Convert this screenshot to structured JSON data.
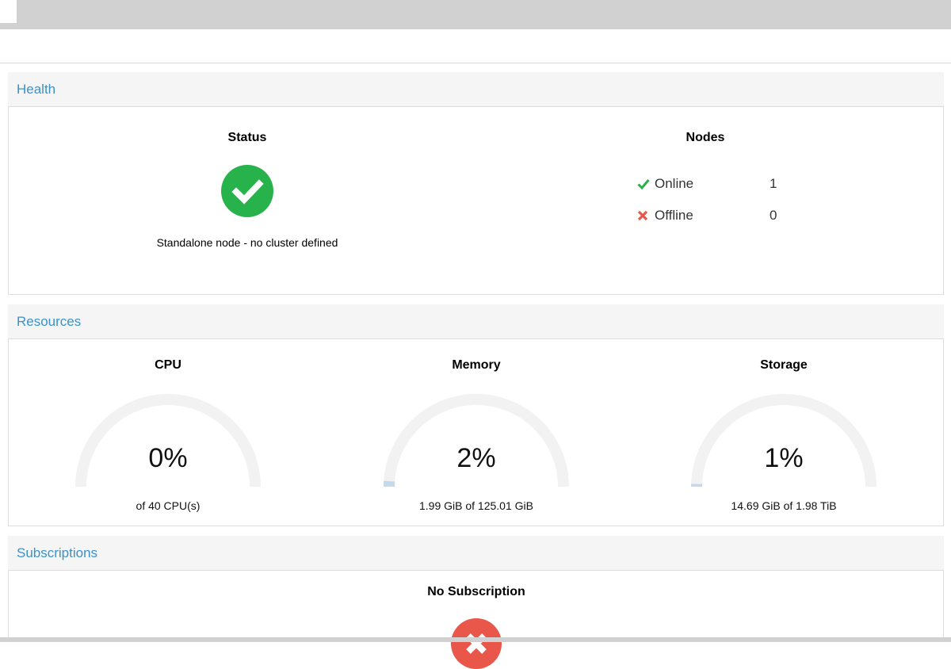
{
  "health": {
    "heading": "Health",
    "status_title": "Status",
    "status_text": "Standalone node - no cluster defined",
    "status_icon": "check-circle-icon",
    "nodes_title": "Nodes",
    "nodes": [
      {
        "label": "Online",
        "value": "1",
        "icon": "check-icon",
        "color": "#28b24b"
      },
      {
        "label": "Offline",
        "value": "0",
        "icon": "x-icon",
        "color": "#e8574a"
      }
    ]
  },
  "resources": {
    "heading": "Resources",
    "items": [
      {
        "title": "CPU",
        "percent_label": "0%",
        "percent": 0,
        "detail": "of 40 CPU(s)"
      },
      {
        "title": "Memory",
        "percent_label": "2%",
        "percent": 2,
        "detail": "1.99 GiB of 125.01 GiB"
      },
      {
        "title": "Storage",
        "percent_label": "1%",
        "percent": 1,
        "detail": "14.69 GiB of 1.98 TiB"
      }
    ]
  },
  "subscriptions": {
    "heading": "Subscriptions",
    "title": "No Subscription",
    "icon": "error-circle-icon"
  },
  "colors": {
    "accent": "#3a92c8",
    "ok": "#28b24b",
    "error": "#e8574a",
    "gauge_track": "#f2f2f2",
    "gauge_fill": "#c3d9ee"
  }
}
